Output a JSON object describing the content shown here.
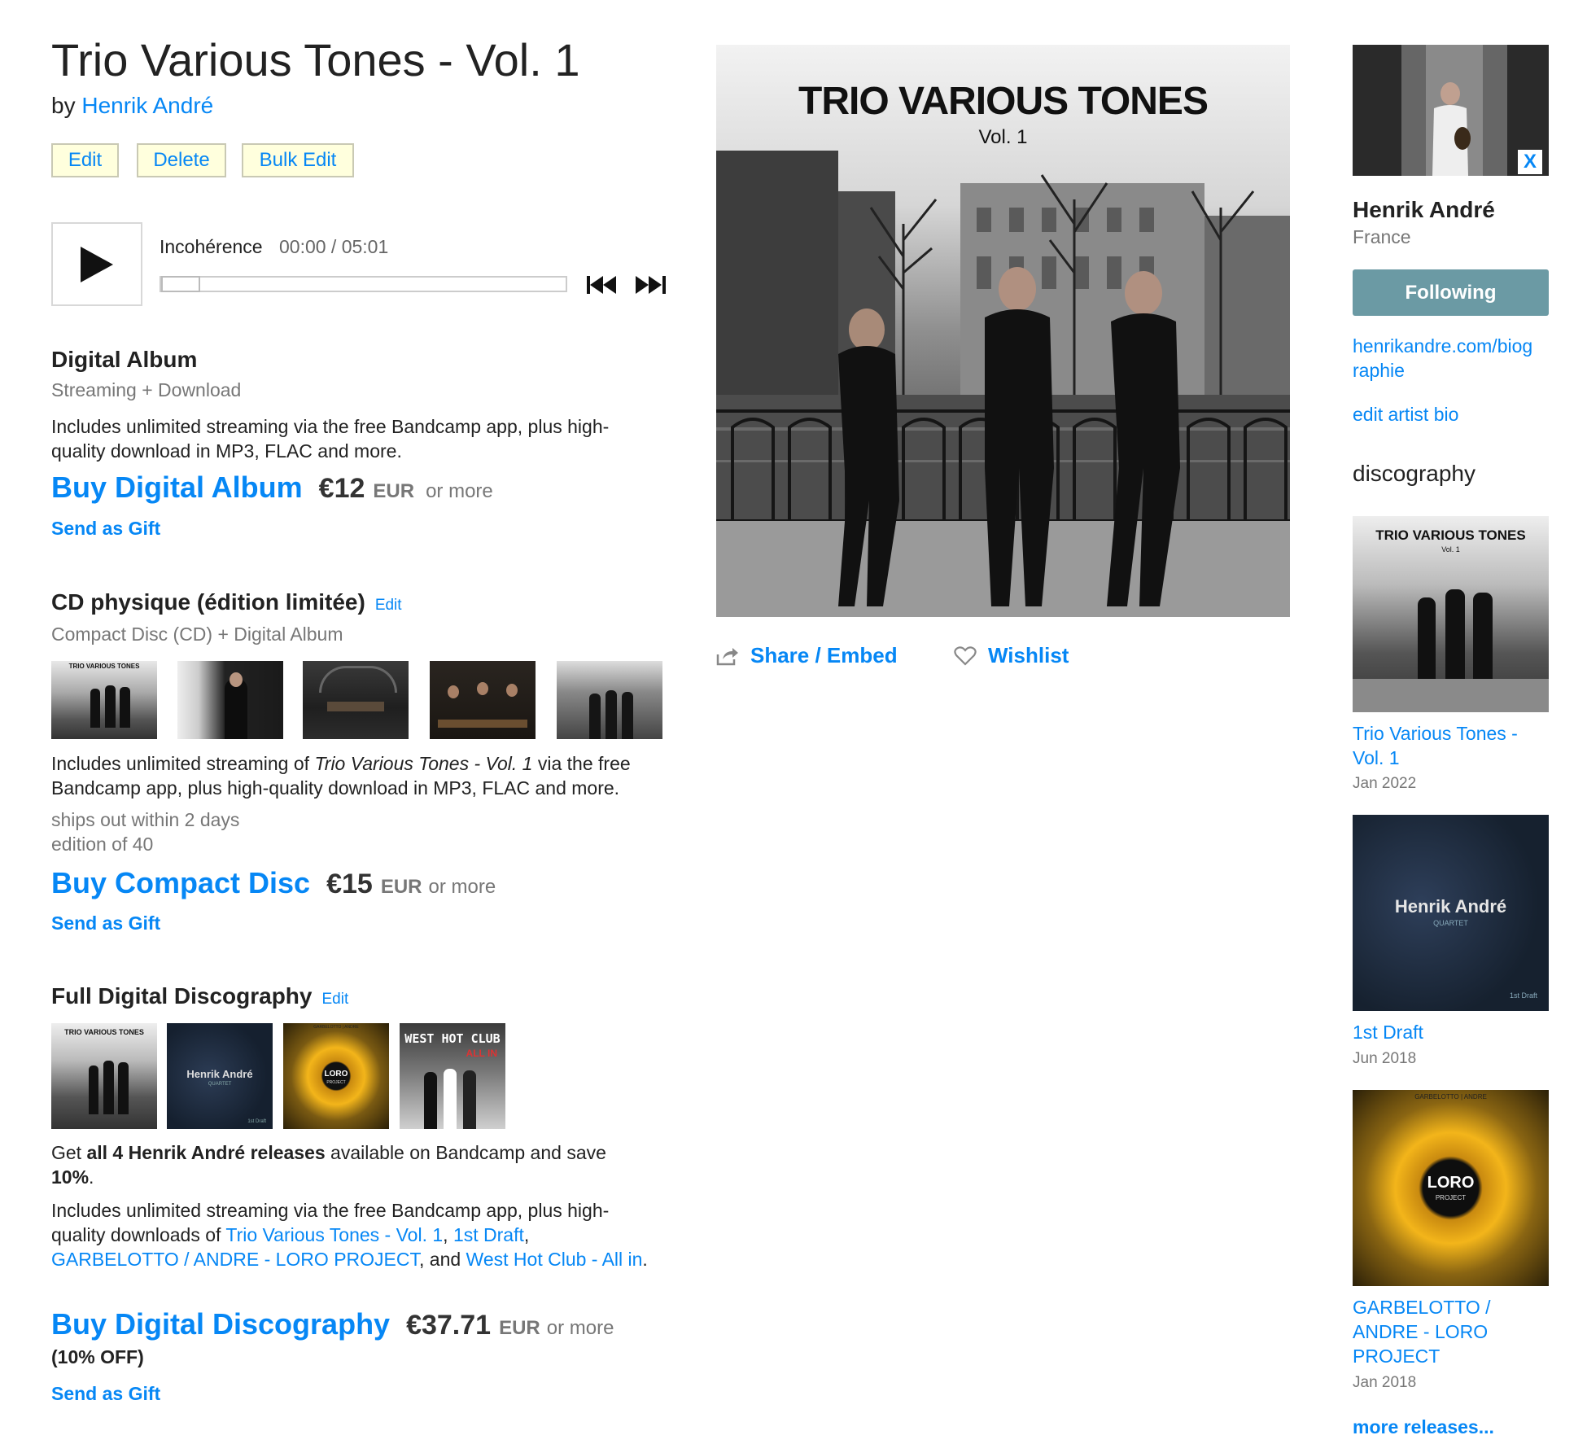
{
  "album": {
    "title": "Trio Various Tones - Vol. 1",
    "by_prefix": "by",
    "artist": "Henrik André"
  },
  "admin": {
    "edit": "Edit",
    "delete": "Delete",
    "bulk_edit": "Bulk Edit"
  },
  "player": {
    "track": "Incohérence",
    "time": "00:00 / 05:01",
    "progress": 0.0
  },
  "digital": {
    "title": "Digital Album",
    "subtitle": "Streaming + Download",
    "description": "Includes unlimited streaming via the free Bandcamp app, plus high-quality download in MP3, FLAC and more.",
    "buy_label": "Buy Digital Album",
    "price": "€12",
    "currency": "EUR",
    "or_more": "or more",
    "gift": "Send as Gift"
  },
  "cd": {
    "title": "CD physique (édition limitée)",
    "edit": "Edit",
    "subtitle": "Compact Disc (CD) + Digital Album",
    "desc_pre": "Includes unlimited streaming of ",
    "desc_italic": "Trio Various Tones - Vol. 1",
    "desc_post": " via the free Bandcamp app, plus high-quality download in MP3, FLAC and more.",
    "ships": "ships out within 2 days",
    "edition": "edition of 40",
    "buy_label": "Buy Compact Disc",
    "price": "€15",
    "currency": "EUR",
    "or_more": "or more",
    "gift": "Send as Gift",
    "thumb1_text": "TRIO VARIOUS TONES"
  },
  "discography_bundle": {
    "title": "Full Digital Discography",
    "edit": "Edit",
    "get_pre": "Get ",
    "get_bold": "all 4 Henrik André releases",
    "get_mid": " available on Bandcamp and save ",
    "get_pct": "10%",
    "get_end": ".",
    "inc_pre": "Includes unlimited streaming via the free Bandcamp app, plus high-quality downloads of ",
    "link1": "Trio Various Tones - Vol. 1",
    "sep1": ", ",
    "link2": "1st Draft",
    "sep2": ", ",
    "link3": "GARBELOTTO / ANDRE - LORO PROJECT",
    "sep3": ", and ",
    "link4": "West Hot Club - All in",
    "end": ".",
    "buy_label": "Buy Digital Discography",
    "price": "€37.71",
    "currency": "EUR",
    "or_more": "or more",
    "off": "(10% OFF)",
    "gift": "Send as Gift",
    "thumbs": {
      "t1": "TRIO VARIOUS TONES",
      "t2": "Henrik André",
      "t2_sub": "QUARTET",
      "t2_foot": "1st Draft",
      "t3": "LORO",
      "t3_sub": "PROJECT",
      "t3_top": "GARBELOTTO | ANDRE",
      "t4": "WEST HOT CLUB",
      "t4_sub": "ALL IN"
    }
  },
  "cover": {
    "title": "TRIO VARIOUS TONES",
    "subtitle": "Vol. 1"
  },
  "actions": {
    "share": "Share / Embed",
    "wishlist": "Wishlist"
  },
  "sidebar": {
    "close": "X",
    "artist": "Henrik André",
    "location": "France",
    "following": "Following",
    "website": "henrikandre.com/biographie",
    "website_line1": "henrikandre.com/biog",
    "website_line2": "raphie",
    "edit_bio": "edit artist bio",
    "discography_heading": "discography",
    "releases": [
      {
        "title": "Trio Various Tones - Vol. 1",
        "line1": "Trio Various Tones -",
        "line2": "Vol. 1",
        "date": "Jan 2022",
        "art_title": "TRIO VARIOUS TONES",
        "art_sub": "Vol. 1"
      },
      {
        "title": "1st Draft",
        "line1": "1st Draft",
        "date": "Jun 2018",
        "art_title": "Henrik André",
        "art_sub": "QUARTET",
        "art_foot": "1st Draft"
      },
      {
        "title": "GARBELOTTO / ANDRE - LORO PROJECT",
        "line1": "GARBELOTTO /",
        "line2": "ANDRE - LORO",
        "line3": "PROJECT",
        "date": "Jan 2018",
        "art_top": "GARBELOTTO | ANDRE",
        "art_title": "LORO",
        "art_sub": "PROJECT"
      }
    ],
    "more": "more releases..."
  },
  "colors": {
    "link": "#0687f5",
    "following_bg": "#6b9aa4",
    "admin_btn_bg": "#ffffdd"
  }
}
